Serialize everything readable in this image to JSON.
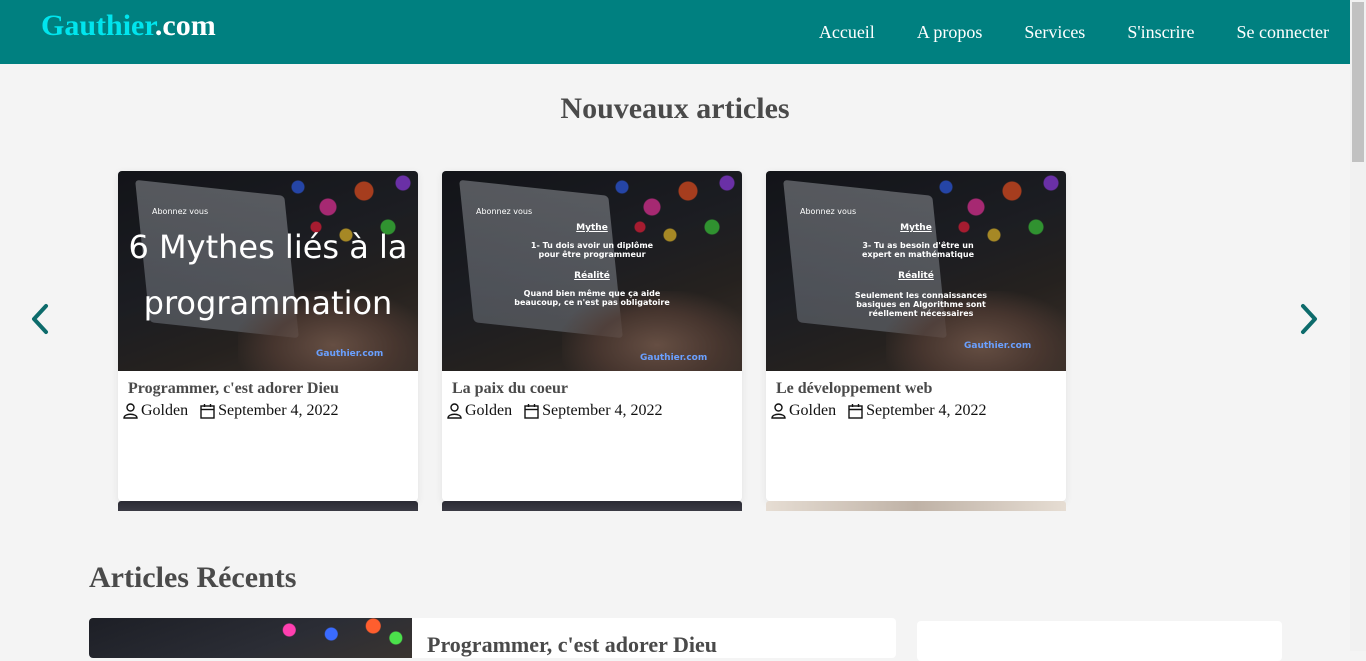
{
  "header": {
    "logo_brand": "Gauthier",
    "logo_tld": ".com",
    "nav": [
      "Accueil",
      "A propos",
      "Services",
      "S'inscrire",
      "Se connecter"
    ]
  },
  "new_articles": {
    "title": "Nouveaux articles",
    "cards": [
      {
        "title": "Programmer, c'est adorer Dieu",
        "author": "Golden",
        "date": "September 4, 2022",
        "image_text": "6 Mythes liés à la programmation",
        "image_subscribe": "Abonnez vous",
        "image_watermark": "Gauthier.com"
      },
      {
        "title": "La paix du coeur",
        "author": "Golden",
        "date": "September 4, 2022",
        "image_subscribe": "Abonnez vous",
        "image_head1": "Mythe",
        "image_line1": "1-  Tu dois avoir un diplôme pour être programmeur",
        "image_head2": "Réalité",
        "image_line2": "Quand bien même que ça aide beaucoup, ce n'est pas obligatoire",
        "image_watermark": "Gauthier.com"
      },
      {
        "title": "Le développement web",
        "author": "Golden",
        "date": "September 4, 2022",
        "image_subscribe": "Abonnez vous",
        "image_head1": "Mythe",
        "image_line1": "3-  Tu as besoin d'être un expert en mathématique",
        "image_head2": "Réalité",
        "image_line2": "Seulement les connaissances basiques en Algorithme sont réellement nécessaires",
        "image_watermark": "Gauthier.com"
      }
    ]
  },
  "recent_articles": {
    "title": "Articles Récents",
    "first_title": "Programmer, c'est adorer Dieu"
  },
  "colors": {
    "header_bg": "#008080",
    "logo_brand": "#00e5ee",
    "page_bg": "#f4f4f4",
    "heading": "#4a4a4a"
  },
  "icons": {
    "carousel_prev": "chevron-left-icon",
    "carousel_next": "chevron-right-icon",
    "author": "user-icon",
    "date": "calendar-icon"
  }
}
